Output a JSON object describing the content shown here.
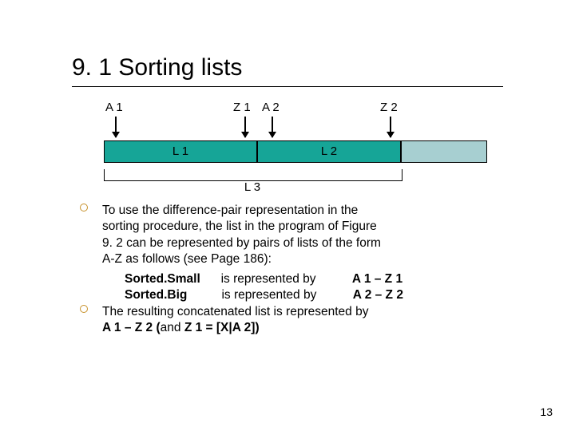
{
  "title": "9. 1 Sorting lists",
  "pointers": {
    "A1": "A 1",
    "Z1": "Z 1",
    "A2": "A 2",
    "Z2": "Z 2"
  },
  "segments": {
    "L1": "L 1",
    "L2": "L 2",
    "L3": "L 3"
  },
  "bullet1_lines": [
    "To use the difference-pair representation in the",
    "sorting procedure, the list in the program of Figure",
    "9. 2 can be represented by pairs of lists of the form",
    "A-Z as follows (see Page 186):"
  ],
  "rep_rows": [
    {
      "name": "Sorted.Small",
      "mid": "is represented by",
      "rhs": "A 1 – Z 1"
    },
    {
      "name": "Sorted.Big",
      "mid": "is represented by",
      "rhs": "A 2 – Z 2"
    }
  ],
  "bullet2_lines": [
    "The resulting concatenated list is represented by"
  ],
  "bullet2_tail_prefix": "A 1 – Z 2 (",
  "bullet2_tail_mid": "and",
  "bullet2_tail_suffix": " Z 1 = [X|A 2])",
  "page_number": "13"
}
